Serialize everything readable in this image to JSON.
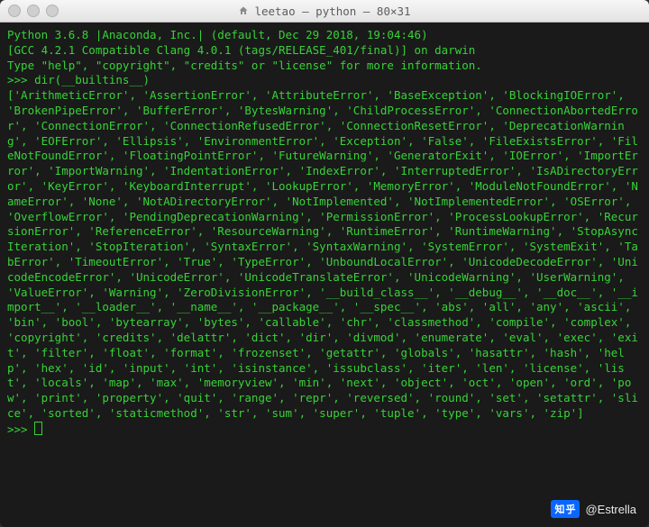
{
  "window": {
    "title": "leetao — python — 80×31",
    "traffic_dim": true
  },
  "intro": {
    "l1": "Python 3.6.8 |Anaconda, Inc.| (default, Dec 29 2018, 19:04:46)",
    "l2": "[GCC 4.2.1 Compatible Clang 4.0.1 (tags/RELEASE_401/final)] on darwin",
    "l3": "Type \"help\", \"copyright\", \"credits\" or \"license\" for more information."
  },
  "prompt1": ">>> dir(__builtins__)",
  "output": "['ArithmeticError', 'AssertionError', 'AttributeError', 'BaseException', 'BlockingIOError', 'BrokenPipeError', 'BufferError', 'BytesWarning', 'ChildProcessError', 'ConnectionAbortedError', 'ConnectionError', 'ConnectionRefusedError', 'ConnectionResetError', 'DeprecationWarning', 'EOFError', 'Ellipsis', 'EnvironmentError', 'Exception', 'False', 'FileExistsError', 'FileNotFoundError', 'FloatingPointError', 'FutureWarning', 'GeneratorExit', 'IOError', 'ImportError', 'ImportWarning', 'IndentationError', 'IndexError', 'InterruptedError', 'IsADirectoryError', 'KeyError', 'KeyboardInterrupt', 'LookupError', 'MemoryError', 'ModuleNotFoundError', 'NameError', 'None', 'NotADirectoryError', 'NotImplemented', 'NotImplementedError', 'OSError', 'OverflowError', 'PendingDeprecationWarning', 'PermissionError', 'ProcessLookupError', 'RecursionError', 'ReferenceError', 'ResourceWarning', 'RuntimeError', 'RuntimeWarning', 'StopAsyncIteration', 'StopIteration', 'SyntaxError', 'SyntaxWarning', 'SystemError', 'SystemExit', 'TabError', 'TimeoutError', 'True', 'TypeError', 'UnboundLocalError', 'UnicodeDecodeError', 'UnicodeEncodeError', 'UnicodeError', 'UnicodeTranslateError', 'UnicodeWarning', 'UserWarning', 'ValueError', 'Warning', 'ZeroDivisionError', '__build_class__', '__debug__', '__doc__', '__import__', '__loader__', '__name__', '__package__', '__spec__', 'abs', 'all', 'any', 'ascii', 'bin', 'bool', 'bytearray', 'bytes', 'callable', 'chr', 'classmethod', 'compile', 'complex', 'copyright', 'credits', 'delattr', 'dict', 'dir', 'divmod', 'enumerate', 'eval', 'exec', 'exit', 'filter', 'float', 'format', 'frozenset', 'getattr', 'globals', 'hasattr', 'hash', 'help', 'hex', 'id', 'input', 'int', 'isinstance', 'issubclass', 'iter', 'len', 'license', 'list', 'locals', 'map', 'max', 'memoryview', 'min', 'next', 'object', 'oct', 'open', 'ord', 'pow', 'print', 'property', 'quit', 'range', 'repr', 'reversed', 'round', 'set', 'setattr', 'slice', 'sorted', 'staticmethod', 'str', 'sum', 'super', 'tuple', 'type', 'vars', 'zip']",
  "prompt2": ">>> ",
  "watermark": {
    "logo": "知乎",
    "author": "@Estrella"
  },
  "colors": {
    "bg": "#1a1a1a",
    "fg": "#38d238"
  }
}
